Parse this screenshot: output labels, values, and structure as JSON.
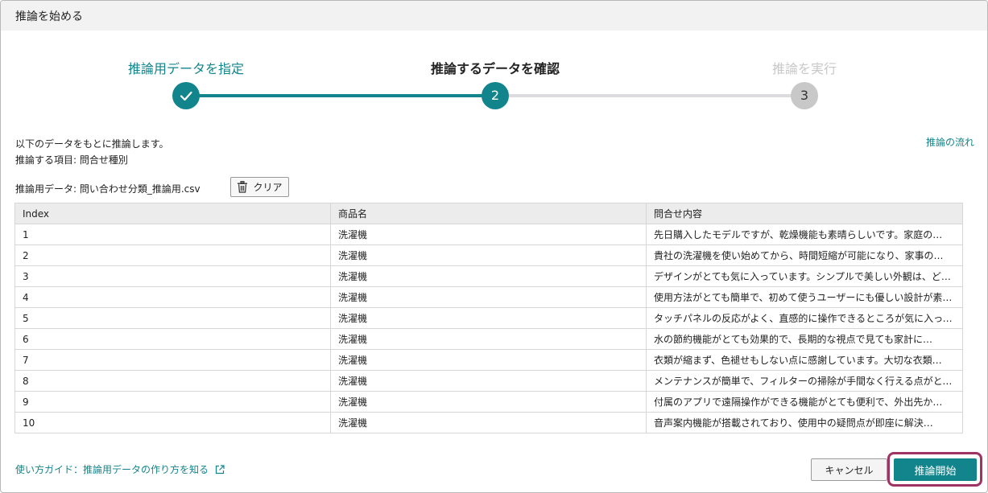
{
  "dialog": {
    "title": "推論を始める"
  },
  "stepper": {
    "steps": [
      {
        "label": "推論用データを指定",
        "state": "done",
        "marker": "✓"
      },
      {
        "label": "推論するデータを確認",
        "state": "active",
        "marker": "2"
      },
      {
        "label": "推論を実行",
        "state": "pending",
        "marker": "3"
      }
    ]
  },
  "description": {
    "line1": "以下のデータをもとに推論します。",
    "line2": "推論する項目: 問合せ種別",
    "flow_link": "推論の流れ"
  },
  "file": {
    "label": "推論用データ: 問い合わせ分類_推論用.csv",
    "clear_label": "クリア"
  },
  "table": {
    "headers": [
      "Index",
      "商品名",
      "問合せ内容"
    ],
    "rows": [
      [
        "1",
        "洗濯機",
        "先日購入したモデルですが、乾燥機能も素晴らしいです。家庭の…"
      ],
      [
        "2",
        "洗濯機",
        "貴社の洗濯機を使い始めてから、時間短縮が可能になり、家事の…"
      ],
      [
        "3",
        "洗濯機",
        "デザインがとても気に入っています。シンプルで美しい外観は、どんな…"
      ],
      [
        "4",
        "洗濯機",
        "使用方法がとても簡単で、初めて使うユーザーにも優しい設計が素…"
      ],
      [
        "5",
        "洗濯機",
        "タッチパネルの反応がよく、直感的に操作できるところが気に入って…"
      ],
      [
        "6",
        "洗濯機",
        "水の節約機能がとても効果的で、長期的な視点で見ても家計に…"
      ],
      [
        "7",
        "洗濯機",
        "衣類が縮まず、色褪せもしない点に感謝しています。大切な衣類…"
      ],
      [
        "8",
        "洗濯機",
        "メンテナンスが簡単で、フィルターの掃除が手間なく行える点がとて…"
      ],
      [
        "9",
        "洗濯機",
        "付属のアプリで遠隔操作ができる機能がとても便利で、外出先か…"
      ],
      [
        "10",
        "洗濯機",
        "音声案内機能が搭載されており、使用中の疑問点が即座に解決…"
      ]
    ]
  },
  "footer": {
    "guide_link": "使い方ガイド：推論用データの作り方を知る",
    "cancel_label": "キャンセル",
    "start_label": "推論開始"
  },
  "colors": {
    "accent": "#12858c",
    "pending": "#c8c8c8",
    "highlight_border": "#a03264"
  },
  "icons": {
    "check": "check-icon",
    "trash": "trash-icon",
    "external_link": "external-link-icon"
  }
}
